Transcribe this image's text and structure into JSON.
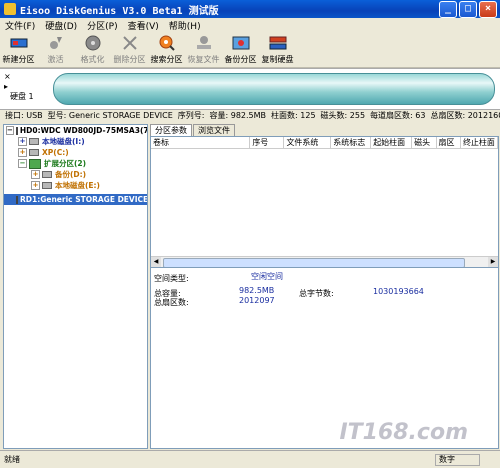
{
  "title": "Eisoo DiskGenius V3.0 Beta1 测试版",
  "window_buttons": [
    "_",
    "□",
    "×"
  ],
  "menu": [
    "文件(F)",
    "硬盘(D)",
    "分区(P)",
    "查看(V)",
    "帮助(H)"
  ],
  "toolbar": [
    {
      "label": "新建分区",
      "icon": "new-partition-icon",
      "enabled": true
    },
    {
      "label": "激活",
      "icon": "activate-icon",
      "enabled": false
    },
    {
      "label": "格式化",
      "icon": "format-icon",
      "enabled": false
    },
    {
      "label": "删除分区",
      "icon": "delete-partition-icon",
      "enabled": false
    },
    {
      "label": "搜索分区",
      "icon": "search-partition-icon",
      "enabled": true
    },
    {
      "label": "恢复文件",
      "icon": "recover-file-icon",
      "enabled": false
    },
    {
      "label": "备份分区",
      "icon": "backup-partition-icon",
      "enabled": true
    },
    {
      "label": "复制硬盘",
      "icon": "copy-disk-icon",
      "enabled": true
    }
  ],
  "disk_map": {
    "label": "硬盘 1"
  },
  "disk_info": {
    "interface": "接口: USB",
    "model": "型号: Generic STORAGE DEVICE",
    "serial": "序列号:",
    "capacity": "容量: 982.5MB",
    "cylinders": "柱面数: 125",
    "heads": "磁头数: 255",
    "sectors": "每道扇区数: 63",
    "total_sectors": "总扇区数: 2012160"
  },
  "tree": {
    "hd0": "HD0:WDC WD800JD-75MSA3(75GB)",
    "local1": "本地磁盘(I:)",
    "xp": "XP(C:)",
    "ext": "扩展分区(2)",
    "backup": "备份(D:)",
    "local2": "本地磁盘(E:)",
    "rd1": "RD1:Generic STORAGE DEVICE"
  },
  "tabs": [
    "分区参数",
    "浏览文件"
  ],
  "columns": [
    "卷标",
    "序号",
    "文件系统",
    "系统标志",
    "起始柱面",
    "磁头",
    "扇区",
    "终止柱面"
  ],
  "details": {
    "space_type_label": "空间类型:",
    "space_type_value": "空闲空间",
    "total_capacity_label": "总容量:",
    "total_capacity_value": "982.5MB",
    "total_bytes_label": "总字节数:",
    "total_bytes_value": "1030193664",
    "total_sectors_label": "总扇区数:",
    "total_sectors_value": "2012097"
  },
  "status": {
    "left": "就绪",
    "right": "数字"
  },
  "watermark": "IT168.com"
}
